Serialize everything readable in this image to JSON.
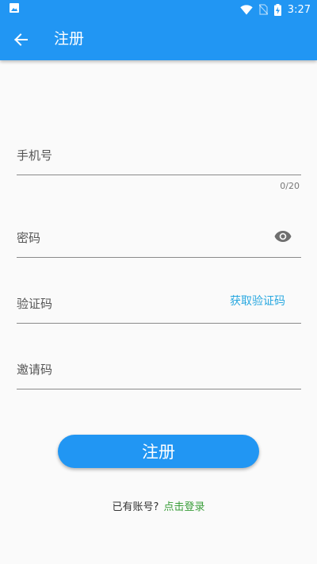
{
  "status_bar": {
    "time": "3:27",
    "icons": [
      "image-icon",
      "wifi-icon",
      "no-sim-icon",
      "battery-charging-icon"
    ]
  },
  "app_bar": {
    "title": "注册",
    "back_icon": "arrow-left-icon"
  },
  "form": {
    "phone": {
      "label": "手机号",
      "counter": "0/20"
    },
    "password": {
      "label": "密码",
      "toggle_icon": "eye-icon"
    },
    "verify_code": {
      "label": "验证码",
      "action": "获取验证码"
    },
    "invite_code": {
      "label": "邀请码"
    }
  },
  "register_button": {
    "label": "注册"
  },
  "login_prompt": {
    "text": "已有账号?",
    "link": "点击登录"
  },
  "colors": {
    "primary": "#2196f3",
    "link_green": "#3a9e3a",
    "action_blue": "#29a8e0",
    "background": "#fafafa"
  }
}
